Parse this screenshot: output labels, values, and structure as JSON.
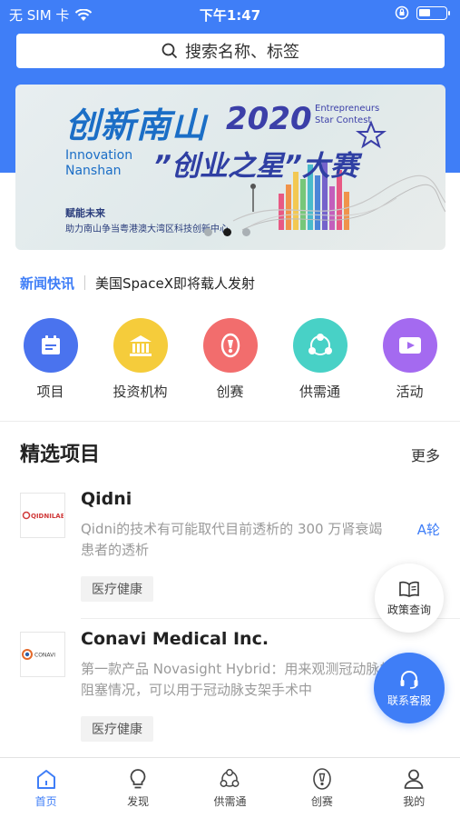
{
  "status_bar": {
    "carrier": "无 SIM 卡",
    "time": "下午1:47"
  },
  "search": {
    "placeholder": "搜索名称、标签"
  },
  "banner": {
    "title": "创新南山",
    "year": "2020",
    "en_right": "Entrepreneurs Star Contest",
    "en_left_1": "Innovation",
    "en_left_2": "Nanshan",
    "subtitle": "”创业之星”大赛",
    "slogan_1": "赋能未来",
    "slogan_2": "助力南山争当粤港澳大湾区科技创新中心",
    "dots": 3,
    "active_dot": 1
  },
  "news": {
    "tag": "新闻快讯",
    "headline": "美国SpaceX即将载人发射"
  },
  "categories": [
    {
      "label": "项目",
      "icon": "calendar-icon",
      "color": "#4a73ee"
    },
    {
      "label": "投资机构",
      "icon": "bank-icon",
      "color": "#f5cc3b"
    },
    {
      "label": "创赛",
      "icon": "medal-icon",
      "color": "#f26d6d"
    },
    {
      "label": "供需通",
      "icon": "network-icon",
      "color": "#48d1c6"
    },
    {
      "label": "活动",
      "icon": "video-icon",
      "color": "#a46af0"
    }
  ],
  "section": {
    "title": "精选项目",
    "more": "更多"
  },
  "projects": [
    {
      "name": "Qidni",
      "logo_text": "QIDNILABS",
      "desc": "Qidni的技术有可能取代目前透析的 300 万肾衰竭患者的透析",
      "round": "A轮",
      "tag": "医疗健康"
    },
    {
      "name": "Conavi Medical Inc.",
      "logo_text": "CONAVI",
      "desc": "第一款产品 Novasight Hybrid：用来观测冠动脉的阻塞情况，可以用于冠动脉支架手术中",
      "round": "",
      "tag": "医疗健康"
    }
  ],
  "floating": {
    "policy": "政策查询",
    "service": "联系客服"
  },
  "tabs": [
    {
      "label": "首页",
      "icon": "home-icon",
      "active": true
    },
    {
      "label": "发现",
      "icon": "bulb-icon",
      "active": false
    },
    {
      "label": "供需通",
      "icon": "network-icon",
      "active": false
    },
    {
      "label": "创赛",
      "icon": "medal-icon",
      "active": false
    },
    {
      "label": "我的",
      "icon": "user-icon",
      "active": false
    }
  ],
  "colors": {
    "primary": "#3f7ef7"
  }
}
